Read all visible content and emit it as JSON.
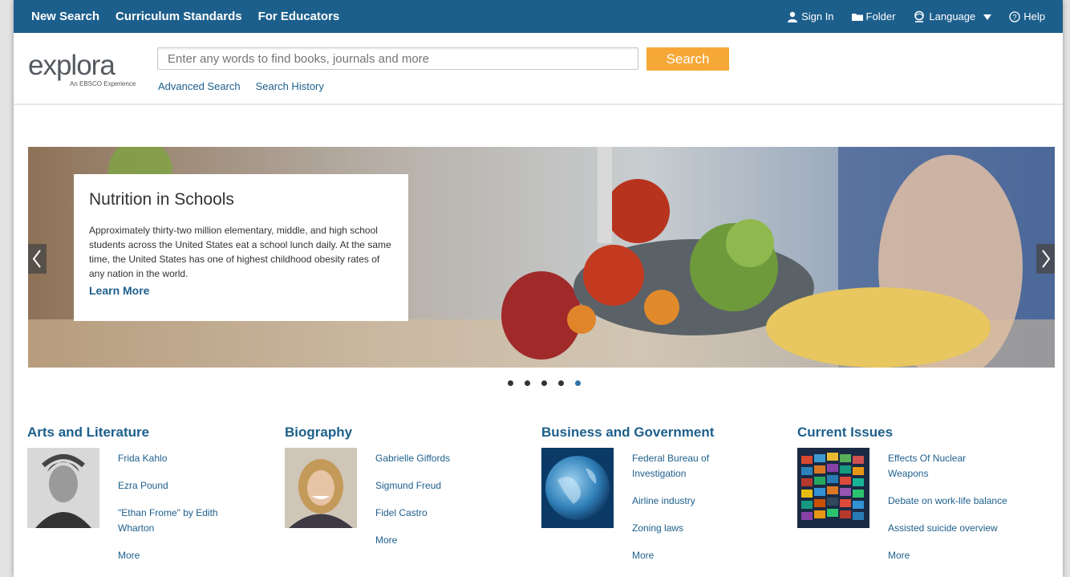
{
  "topnav": {
    "new_search": "New Search",
    "curriculum": "Curriculum Standards",
    "educators": "For Educators"
  },
  "utility": {
    "sign_in": "Sign In",
    "folder": "Folder",
    "language": "Language",
    "help": "Help"
  },
  "logo": {
    "text": "explora",
    "tagline": "An EBSCO Experience"
  },
  "search": {
    "placeholder": "Enter any words to find books, journals and more",
    "button": "Search",
    "advanced": "Advanced Search",
    "history": "Search History"
  },
  "hero": {
    "title": "Nutrition in Schools",
    "description": "Approximately thirty-two million elementary, middle, and high school students across the United States eat a school lunch daily. At the same time, the United States has one of highest childhood obesity rates of any nation in the world.",
    "learn_more": "Learn More",
    "dots_count": 5,
    "active_dot": 5
  },
  "categories": [
    {
      "title": "Arts and Literature",
      "links": [
        "Frida Kahlo",
        "Ezra Pound",
        "\"Ethan Frome\" by Edith Wharton",
        "More"
      ]
    },
    {
      "title": "Biography",
      "links": [
        "Gabrielle Giffords",
        "Sigmund Freud",
        "Fidel Castro",
        "More"
      ]
    },
    {
      "title": "Business and Government",
      "links": [
        "Federal Bureau of Investigation",
        "Airline industry",
        "Zoning laws",
        "More"
      ]
    },
    {
      "title": "Current Issues",
      "links": [
        "Effects Of Nuclear Weapons",
        "Debate on work-life balance",
        "Assisted suicide overview",
        "More"
      ]
    }
  ],
  "colors": {
    "brand_blue": "#1d5f8c",
    "search_orange": "#f6a836",
    "active_dot": "#2f73a8"
  }
}
